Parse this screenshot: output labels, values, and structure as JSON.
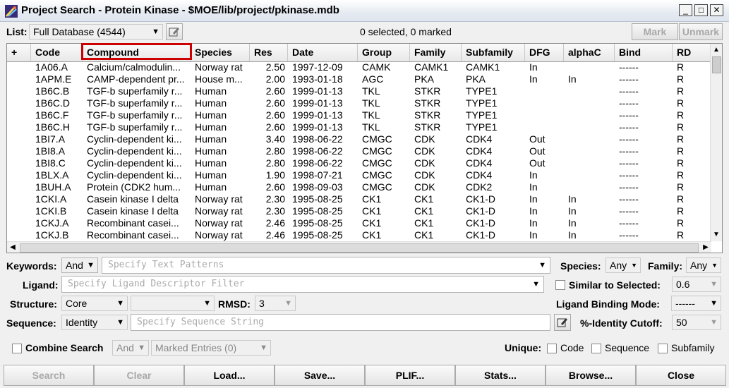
{
  "window": {
    "title": "Project Search - Protein Kinase - $MOE/lib/project/pkinase.mdb"
  },
  "list": {
    "label": "List:",
    "value": "Full Database (4544)",
    "status": "0 selected, 0 marked",
    "mark": "Mark",
    "unmark": "Unmark"
  },
  "grid": {
    "columns": [
      "+",
      "Code",
      "Compound",
      "Species",
      "Res",
      "Date",
      "Group",
      "Family",
      "Subfamily",
      "DFG",
      "alphaC",
      "Bind",
      "RD"
    ],
    "rows": [
      [
        "",
        "1A06.A",
        "Calcium/calmodulin...",
        "Norway rat",
        "2.50",
        "1997-12-09",
        "CAMK",
        "CAMK1",
        "CAMK1",
        "In",
        "",
        "------",
        "R"
      ],
      [
        "",
        "1APM.E",
        "CAMP-dependent pr...",
        "House m...",
        "2.00",
        "1993-01-18",
        "AGC",
        "PKA",
        "PKA",
        "In",
        "In",
        "------",
        "R"
      ],
      [
        "",
        "1B6C.B",
        "TGF-b superfamily r...",
        "Human",
        "2.60",
        "1999-01-13",
        "TKL",
        "STKR",
        "TYPE1",
        "",
        "",
        "------",
        "R"
      ],
      [
        "",
        "1B6C.D",
        "TGF-b superfamily r...",
        "Human",
        "2.60",
        "1999-01-13",
        "TKL",
        "STKR",
        "TYPE1",
        "",
        "",
        "------",
        "R"
      ],
      [
        "",
        "1B6C.F",
        "TGF-b superfamily r...",
        "Human",
        "2.60",
        "1999-01-13",
        "TKL",
        "STKR",
        "TYPE1",
        "",
        "",
        "------",
        "R"
      ],
      [
        "",
        "1B6C.H",
        "TGF-b superfamily r...",
        "Human",
        "2.60",
        "1999-01-13",
        "TKL",
        "STKR",
        "TYPE1",
        "",
        "",
        "------",
        "R"
      ],
      [
        "",
        "1BI7.A",
        "Cyclin-dependent ki...",
        "Human",
        "3.40",
        "1998-06-22",
        "CMGC",
        "CDK",
        "CDK4",
        "Out",
        "",
        "------",
        "R"
      ],
      [
        "",
        "1BI8.A",
        "Cyclin-dependent ki...",
        "Human",
        "2.80",
        "1998-06-22",
        "CMGC",
        "CDK",
        "CDK4",
        "Out",
        "",
        "------",
        "R"
      ],
      [
        "",
        "1BI8.C",
        "Cyclin-dependent ki...",
        "Human",
        "2.80",
        "1998-06-22",
        "CMGC",
        "CDK",
        "CDK4",
        "Out",
        "",
        "------",
        "R"
      ],
      [
        "",
        "1BLX.A",
        "Cyclin-dependent ki...",
        "Human",
        "1.90",
        "1998-07-21",
        "CMGC",
        "CDK",
        "CDK4",
        "In",
        "",
        "------",
        "R"
      ],
      [
        "",
        "1BUH.A",
        "Protein (CDK2 hum...",
        "Human",
        "2.60",
        "1998-09-03",
        "CMGC",
        "CDK",
        "CDK2",
        "In",
        "",
        "------",
        "R"
      ],
      [
        "",
        "1CKI.A",
        "Casein kinase I delta",
        "Norway rat",
        "2.30",
        "1995-08-25",
        "CK1",
        "CK1",
        "CK1-D",
        "In",
        "In",
        "------",
        "R"
      ],
      [
        "",
        "1CKI.B",
        "Casein kinase I delta",
        "Norway rat",
        "2.30",
        "1995-08-25",
        "CK1",
        "CK1",
        "CK1-D",
        "In",
        "In",
        "------",
        "R"
      ],
      [
        "",
        "1CKJ.A",
        "Recombinant casei...",
        "Norway rat",
        "2.46",
        "1995-08-25",
        "CK1",
        "CK1",
        "CK1-D",
        "In",
        "In",
        "------",
        "R"
      ],
      [
        "",
        "1CKJ.B",
        "Recombinant casei...",
        "Norway rat",
        "2.46",
        "1995-08-25",
        "CK1",
        "CK1",
        "CK1-D",
        "In",
        "In",
        "------",
        "R"
      ]
    ]
  },
  "filters": {
    "keywords_label": "Keywords:",
    "keywords_op": "And",
    "keywords_placeholder": "Specify Text Patterns",
    "species_label": "Species:",
    "species_value": "Any",
    "family_label": "Family:",
    "family_value": "Any",
    "ligand_label": "Ligand:",
    "ligand_placeholder": "Specify Ligand Descriptor Filter",
    "similar_label": "Similar to Selected:",
    "similar_value": "0.6",
    "structure_label": "Structure:",
    "structure_value": "Core",
    "structure_value2": "",
    "rmsd_label": "RMSD:",
    "rmsd_value": "3",
    "binding_mode_label": "Ligand Binding Mode:",
    "binding_mode_value": "------",
    "sequence_label": "Sequence:",
    "sequence_value": "Identity",
    "sequence_placeholder": "Specify Sequence String",
    "identity_label": "%-Identity Cutoff:",
    "identity_value": "50",
    "combine_label": "Combine Search",
    "combine_op": "And",
    "combine_entries": "Marked Entries (0)",
    "unique_label": "Unique:",
    "unique_code": "Code",
    "unique_sequence": "Sequence",
    "unique_subfamily": "Subfamily"
  },
  "buttons": {
    "search": "Search",
    "clear": "Clear",
    "load": "Load...",
    "save": "Save...",
    "plif": "PLIF...",
    "stats": "Stats...",
    "browse": "Browse...",
    "close": "Close"
  }
}
